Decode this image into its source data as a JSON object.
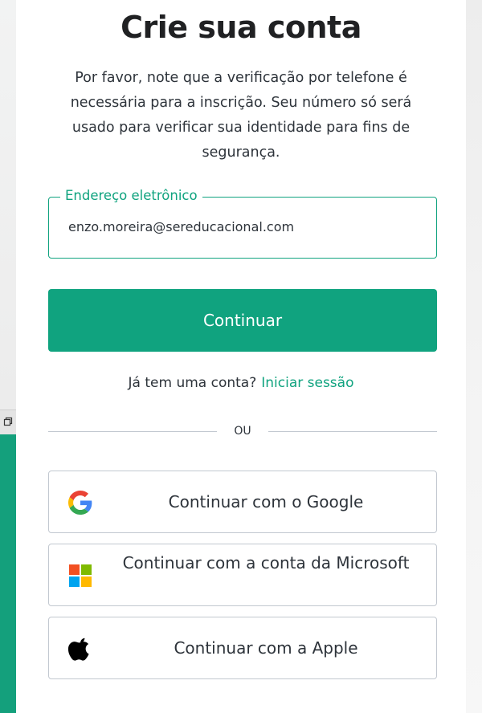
{
  "background_window": {
    "icon": "copy-icon",
    "accent_color": "#14a07c"
  },
  "signup": {
    "title": "Crie sua conta",
    "subtitle": "Por favor, note que a verificação por telefone é necessária para a inscrição. Seu número só será usado para verificar sua identidade para fins de segurança.",
    "email_field": {
      "label": "Endereço eletrônico",
      "value": "enzo.moreira@sereducacional.com"
    },
    "continue_label": "Continuar",
    "login_prompt": "Já tem uma conta?",
    "login_link": "Iniciar sessão",
    "divider_text": "OU",
    "social_buttons": [
      {
        "label": "Continuar com o Google",
        "icon": "google-icon"
      },
      {
        "label": "Continuar com a conta da Microsoft",
        "icon": "microsoft-icon"
      },
      {
        "label": "Continuar com a Apple",
        "icon": "apple-icon"
      }
    ]
  },
  "colors": {
    "accent": "#10a37f",
    "text": "#2d333a",
    "title": "#202123",
    "border": "#c2c8d0"
  }
}
